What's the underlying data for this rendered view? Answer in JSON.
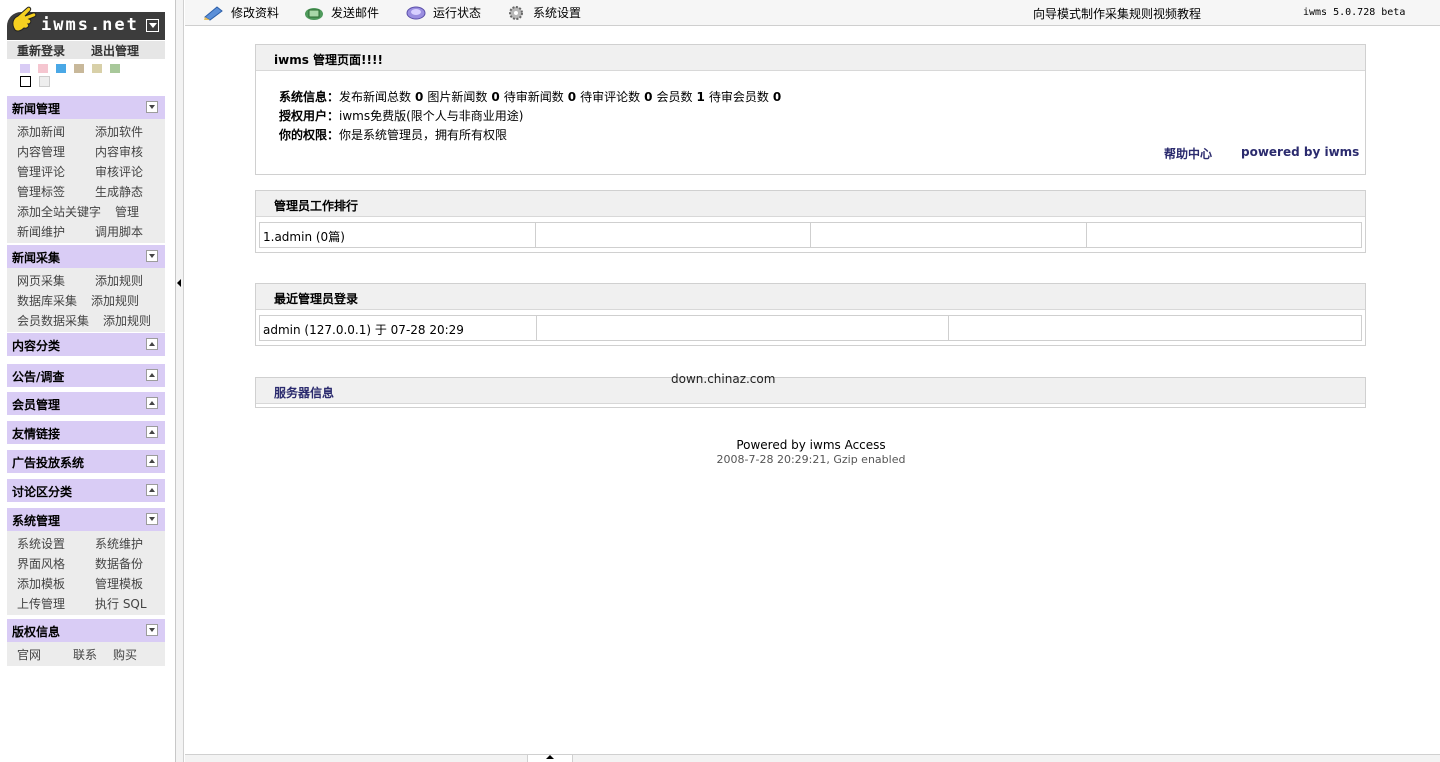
{
  "sidebar": {
    "logo_text": "iwms.net",
    "login": {
      "relogin": "重新登录",
      "logout": "退出管理"
    },
    "swatch_colors": [
      "#d9ccf5",
      "#f5c6d0",
      "#4aa8e6",
      "#c8b89a",
      "#d8d0a8",
      "#a8c89a"
    ],
    "swatch_colors2": [
      "#ffffff",
      "#eeeeee"
    ],
    "sections": [
      {
        "title": "新闻管理",
        "expanded": true,
        "rows": [
          [
            "添加新闻",
            "添加软件"
          ],
          [
            "内容管理",
            "内容审核"
          ],
          [
            "管理评论",
            "审核评论"
          ],
          [
            "管理标签",
            "生成静态"
          ],
          [
            "添加全站关键字",
            "管理"
          ],
          [
            "新闻维护",
            "调用脚本"
          ]
        ]
      },
      {
        "title": "新闻采集",
        "expanded": true,
        "rows": [
          [
            "网页采集",
            "添加规则"
          ],
          [
            "数据库采集",
            "添加规则"
          ],
          [
            "会员数据采集",
            "添加规则"
          ]
        ]
      },
      {
        "title": "内容分类",
        "expanded": false,
        "rows": []
      },
      {
        "title": "公告/调查",
        "expanded": false,
        "rows": []
      },
      {
        "title": "会员管理",
        "expanded": false,
        "rows": []
      },
      {
        "title": "友情链接",
        "expanded": false,
        "rows": []
      },
      {
        "title": "广告投放系统",
        "expanded": false,
        "rows": []
      },
      {
        "title": "讨论区分类",
        "expanded": false,
        "rows": []
      },
      {
        "title": "系统管理",
        "expanded": true,
        "rows": [
          [
            "系统设置",
            "系统维护"
          ],
          [
            "界面风格",
            "数据备份"
          ],
          [
            "添加模板",
            "管理模板"
          ],
          [
            "上传管理",
            "执行 SQL"
          ]
        ]
      },
      {
        "title": "版权信息",
        "expanded": true,
        "rows": [
          [
            "官网",
            "联系",
            "购买"
          ]
        ]
      }
    ]
  },
  "toolbar": {
    "items": [
      "修改资料",
      "发送邮件",
      "运行状态",
      "系统设置"
    ],
    "tutorial": "向导模式制作采集规则视频教程",
    "version": "iwms 5.0.728 beta"
  },
  "main": {
    "panel1": {
      "title": "iwms 管理页面!!!!",
      "sysinfo_label": "系统信息：",
      "sysinfo": [
        {
          "label": "发布新闻总数",
          "value": "0"
        },
        {
          "label": "图片新闻数",
          "value": "0"
        },
        {
          "label": "待审新闻数",
          "value": "0"
        },
        {
          "label": "待审评论数",
          "value": "0"
        },
        {
          "label": "会员数",
          "value": "1"
        },
        {
          "label": "待审会员数",
          "value": "0"
        }
      ],
      "license_label": "授权用户：",
      "license": "iwms免费版(限个人与非商业用途)",
      "perm_label": "你的权限：",
      "perm": "你是系统管理员，拥有所有权限",
      "help_link": "帮助中心",
      "powered_link": "powered by iwms"
    },
    "panel2": {
      "title": "管理员工作排行",
      "rank_user": "1.admin",
      "rank_count": " (0篇)"
    },
    "panel3": {
      "title": "最近管理员登录",
      "login_user": "admin",
      "login_info": " (127.0.0.1) 于 07-28 20:29"
    },
    "panel4": {
      "title": "服务器信息"
    },
    "watermark": "down.chinaz.com",
    "footer_powered": "Powered by iwms Access",
    "footer_time": "2008-7-28 20:29:21, Gzip enabled"
  }
}
